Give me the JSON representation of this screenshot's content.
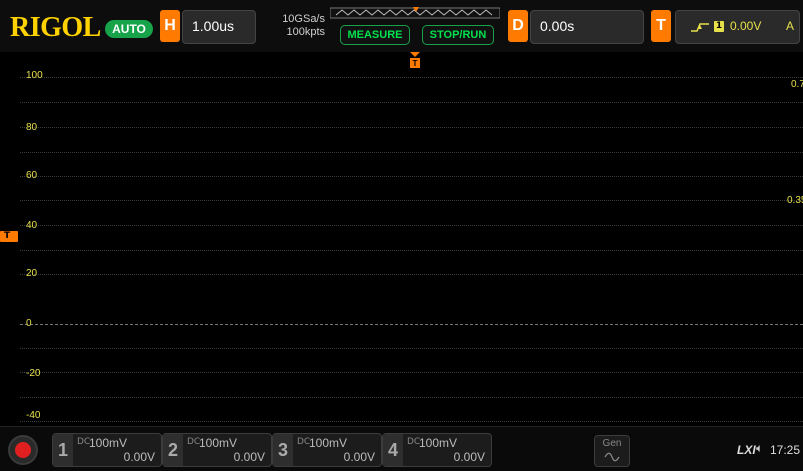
{
  "header": {
    "brand": "RIGOL",
    "mode": "AUTO",
    "horizontal": {
      "letter": "H",
      "timebase": "1.00us"
    },
    "sample_rate": "10GSa/s",
    "memory_depth": "100kpts",
    "measure_label": "MEASURE",
    "stop_run_label": "STOP/RUN",
    "delay": {
      "letter": "D",
      "value": "0.00s"
    },
    "trigger": {
      "letter": "T",
      "source_chip": "1",
      "level": "0.00V",
      "mode_abbrev": "A"
    }
  },
  "screen": {
    "y_labels": [
      "100",
      "80",
      "60",
      "40",
      "20",
      "0",
      "-20",
      "-40"
    ],
    "right_labels": [
      "0.7",
      "0.35"
    ],
    "trigger_marker_label": "T"
  },
  "channels": [
    {
      "num": "1",
      "coupling": "DC",
      "scale": "100mV",
      "offset": "0.00V"
    },
    {
      "num": "2",
      "coupling": "DC",
      "scale": "100mV",
      "offset": "0.00V"
    },
    {
      "num": "3",
      "coupling": "DC",
      "scale": "100mV",
      "offset": "0.00V"
    },
    {
      "num": "4",
      "coupling": "DC",
      "scale": "100mV",
      "offset": "0.00V"
    }
  ],
  "footer": {
    "gen_label": "Gen",
    "lxi_label": "LXI",
    "clock": "17:25"
  },
  "colors": {
    "accent_orange": "#ff7a00",
    "brand_yellow": "#ffd200",
    "run_green": "#16a34a",
    "label_yellow": "#e6e04a"
  }
}
